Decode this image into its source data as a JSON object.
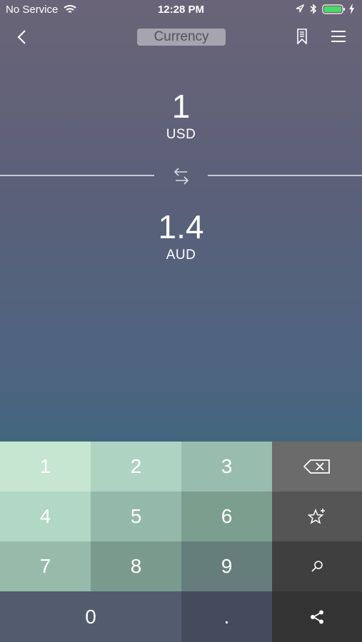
{
  "status_bar": {
    "carrier": "No Service",
    "time": "12:28 PM",
    "icons": [
      "wifi-icon",
      "location-icon",
      "bluetooth-icon",
      "battery-icon",
      "charging-icon"
    ]
  },
  "nav": {
    "title": "Currency",
    "icons": [
      "back-icon",
      "bookmark-icon",
      "menu-icon"
    ]
  },
  "conversion": {
    "from_amount": "1",
    "from_currency": "USD",
    "to_amount": "1.4",
    "to_currency": "AUD",
    "swap_icon": "swap-arrows-icon"
  },
  "keypad": {
    "keys": {
      "k1": "1",
      "k2": "2",
      "k3": "3",
      "k4": "4",
      "k5": "5",
      "k6": "6",
      "k7": "7",
      "k8": "8",
      "k9": "9",
      "k0": "0",
      "dot": "."
    },
    "action_icons": [
      "backspace-icon",
      "favorite-star-icon",
      "search-icon",
      "share-icon"
    ]
  },
  "colors": {
    "key_1": "#c6e6d2",
    "key_2": "#afd3c3",
    "key_3": "#98bcad",
    "key_4": "#b0d8c5",
    "key_5": "#93b9aa",
    "key_6": "#7b9e8f",
    "key_7": "#98baab",
    "key_8": "#7a9a8d",
    "key_9": "#657e7c",
    "key_0": "#525c6e",
    "key_dot": "#454b5d",
    "action_1": "#6b6b6b",
    "action_2": "#555555",
    "action_3": "#3f3f3f",
    "action_4": "#333333"
  }
}
